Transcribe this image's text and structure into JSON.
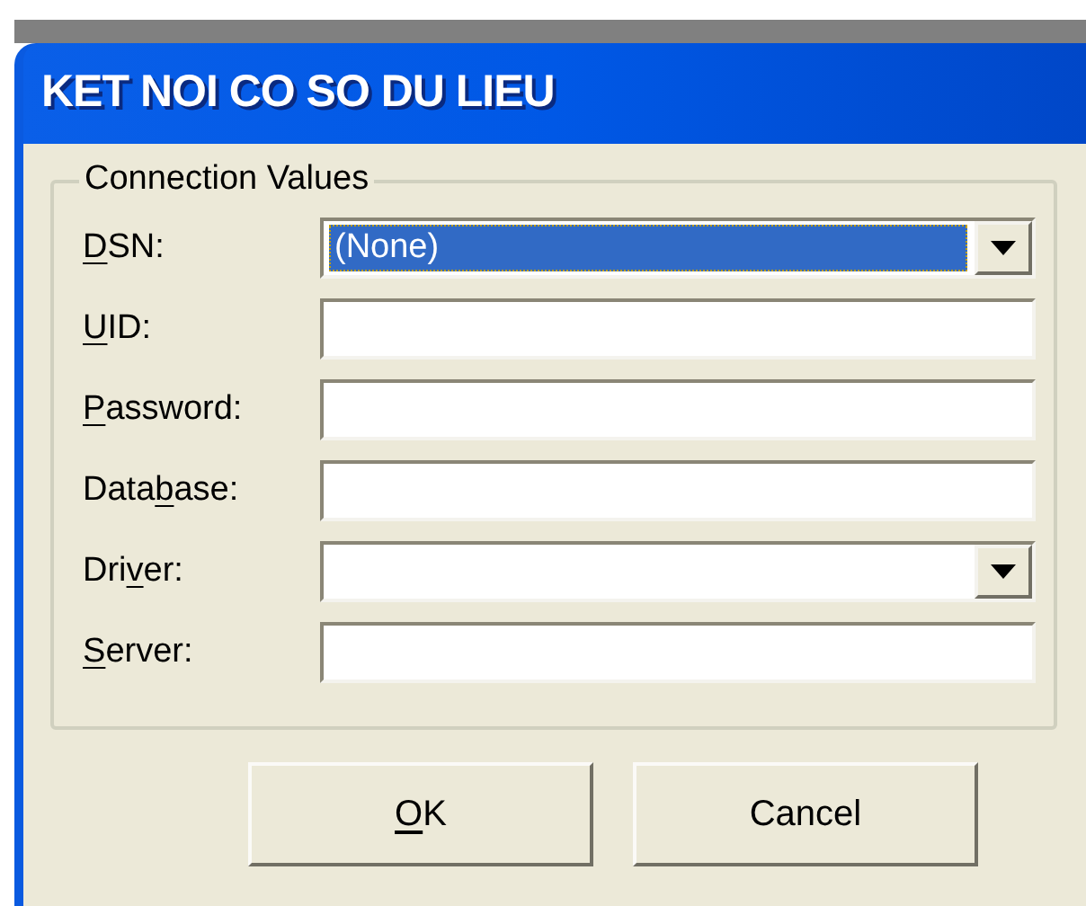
{
  "window": {
    "title": "KET NOI CO SO DU LIEU"
  },
  "group": {
    "title": "Connection Values",
    "fields": [
      {
        "kind": "combo",
        "access_key": "D",
        "label_after": "SN:",
        "value": "(None)",
        "focused": true
      },
      {
        "kind": "text",
        "access_key": "U",
        "label_after": "ID:",
        "focused": false
      },
      {
        "kind": "text",
        "access_key": "P",
        "label_after": "assword:",
        "focused": false
      },
      {
        "kind": "text",
        "label_before": "Data",
        "access_key": "b",
        "label_after": "ase:",
        "focused": false
      },
      {
        "kind": "combo",
        "label_before": "Dri",
        "access_key": "v",
        "label_after": "er:",
        "focused": false
      },
      {
        "kind": "text",
        "access_key": "S",
        "label_after": "erver:",
        "focused": false
      }
    ]
  },
  "buttons": [
    {
      "access_key": "O",
      "label_after": "K"
    },
    {
      "label": "Cancel"
    }
  ]
}
